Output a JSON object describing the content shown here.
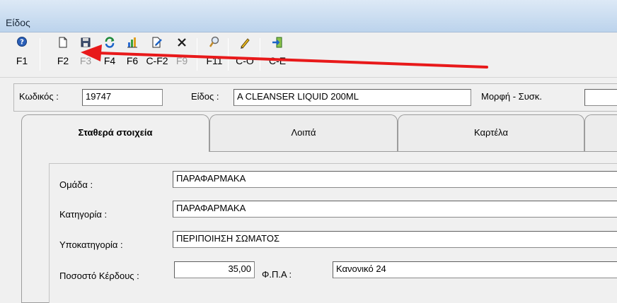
{
  "window": {
    "title": "Είδος"
  },
  "toolbar": {
    "buttons": [
      {
        "key": "F1",
        "icon": "help-icon",
        "enabled": true
      },
      {
        "key": "F2",
        "icon": "new-document-icon",
        "enabled": true
      },
      {
        "key": "F3",
        "icon": "save-icon",
        "enabled": false
      },
      {
        "key": "F4",
        "icon": "refresh-icon",
        "enabled": true
      },
      {
        "key": "F6",
        "icon": "chart-icon",
        "enabled": true
      },
      {
        "key": "C-F2",
        "icon": "edit-document-icon",
        "enabled": true
      },
      {
        "key": "F9",
        "icon": "delete-icon",
        "enabled": false
      },
      {
        "key": "F11",
        "icon": "search-icon",
        "enabled": true
      },
      {
        "key": "C-O",
        "icon": "pencil-icon",
        "enabled": true
      },
      {
        "key": "C-E",
        "icon": "exit-icon",
        "enabled": true
      }
    ]
  },
  "annotation": {
    "arrow_color": "#e8191a"
  },
  "header": {
    "code_label": "Κωδικός :",
    "code_value": "19747",
    "item_label": "Είδος :",
    "item_value": "A CLEANSER LIQUID 200ML",
    "form_label": "Μορφή - Συσκ.",
    "form_value": ""
  },
  "tabs": [
    {
      "label": "Σταθερά στοιχεία",
      "active": true
    },
    {
      "label": "Λοιπά",
      "active": false
    },
    {
      "label": "Καρτέλα",
      "active": false
    },
    {
      "label": "",
      "active": false
    }
  ],
  "form": {
    "group_label": "Ομάδα :",
    "group_value": "ΠΑΡΑΦΑΡΜΑΚΑ",
    "category_label": "Κατηγορία :",
    "category_value": "ΠΑΡΑΦΑΡΜΑΚΑ",
    "subcategory_label": "Υποκατηγορία :",
    "subcategory_value": "ΠΕΡΙΠΟΙΗΣΗ ΣΩΜΑΤΟΣ",
    "profit_label": "Ποσοστό Κέρδους :",
    "profit_value": "35,00",
    "vat_label": "Φ.Π.Α :",
    "vat_value": "Κανονικό 24"
  }
}
